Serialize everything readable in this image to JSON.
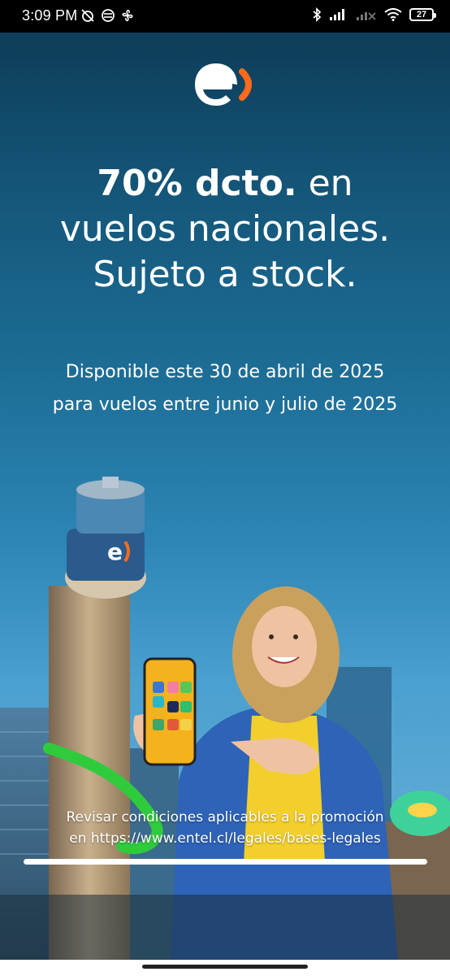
{
  "status_bar": {
    "time": "3:09 PM",
    "battery": "27"
  },
  "ad": {
    "brand": "entel",
    "headline_bold": "70% dcto.",
    "headline_line1_rest": " en",
    "headline_line2": "vuelos nacionales.",
    "headline_line3": "Sujeto a stock.",
    "sub_line1": "Disponible este 30 de abril de 2025",
    "sub_line2": "para vuelos entre junio y julio de 2025",
    "legal_line1": "Revisar condiciones aplicables a la promoción",
    "legal_line2": "en https://www.entel.cl/legales/bases-legales",
    "story_progress": 1.0
  },
  "colors": {
    "brand_orange": "#ff6b1a",
    "sky_top": "#0d3d59",
    "sky_bottom": "#5aa8d4"
  }
}
